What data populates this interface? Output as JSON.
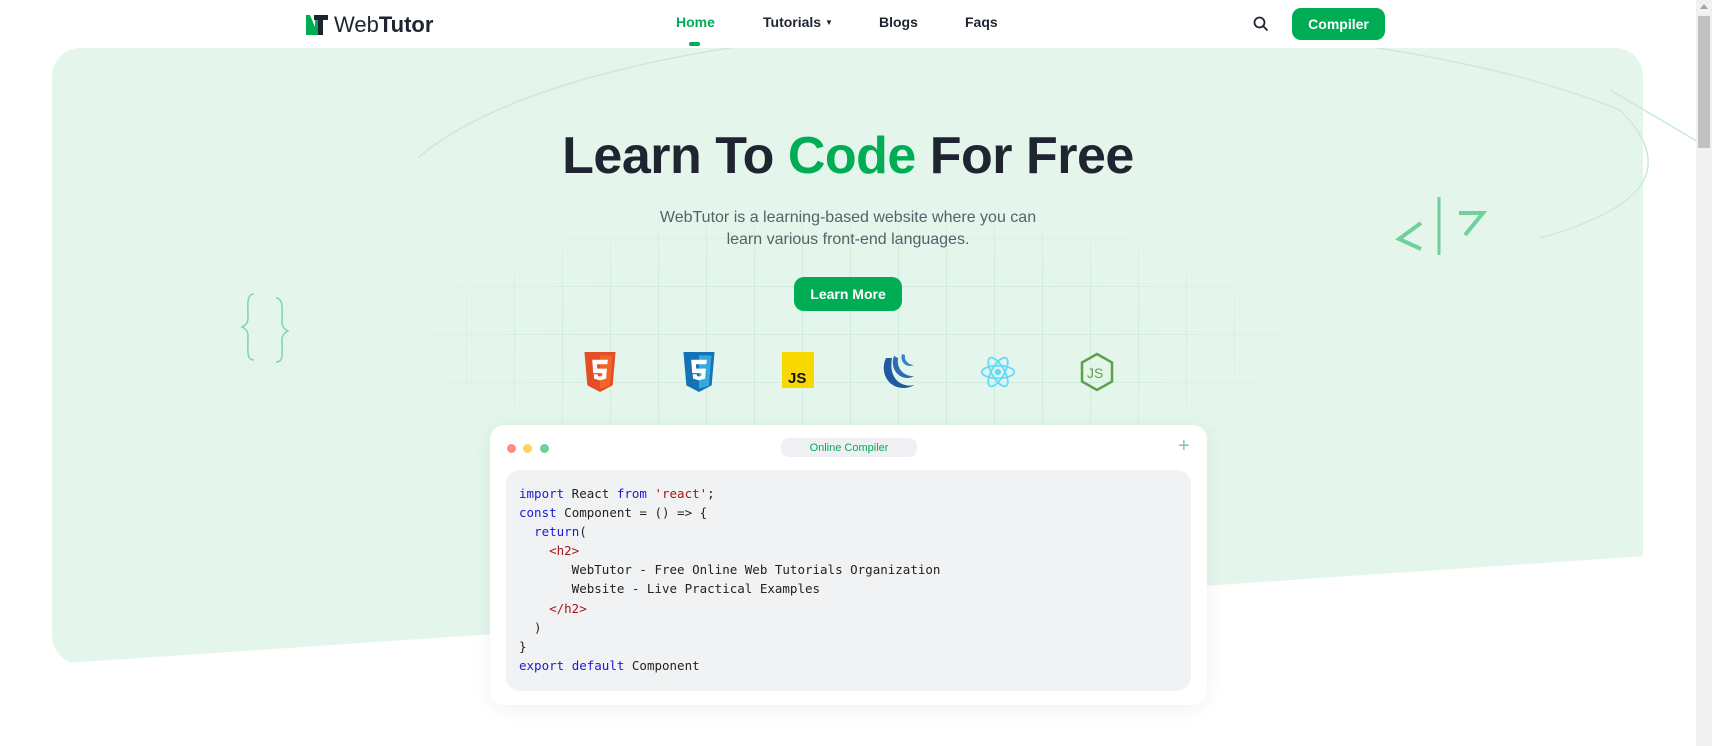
{
  "nav": {
    "brand_light": "Web",
    "brand_bold": "Tutor",
    "links": [
      {
        "label": "Home",
        "active": true
      },
      {
        "label": "Tutorials"
      },
      {
        "label": "Blogs"
      },
      {
        "label": "Faqs"
      }
    ],
    "compiler_label": "Compiler"
  },
  "hero": {
    "title_pre": "Learn To ",
    "title_accent": "Code",
    "title_post": " For Free",
    "subtitle_line1": "WebTutor is a learning-based website where you can",
    "subtitle_line2": "learn various front-end languages.",
    "cta": "Learn More",
    "tech_icons": [
      "html5-icon",
      "css3-icon",
      "javascript-icon",
      "jquery-icon",
      "react-icon",
      "nodejs-icon"
    ]
  },
  "compiler": {
    "title": "Online Compiler",
    "code": [
      [
        [
          "kw",
          "import"
        ],
        [
          "t",
          " React "
        ],
        [
          "kw",
          "from"
        ],
        [
          "t",
          " "
        ],
        [
          "str",
          "'react'"
        ],
        [
          "t",
          ";"
        ]
      ],
      [
        [
          "kw",
          "const"
        ],
        [
          "t",
          " Component = () => {"
        ]
      ],
      [
        [
          "t",
          "  "
        ],
        [
          "kw",
          "return"
        ],
        [
          "t",
          "("
        ]
      ],
      [
        [
          "t",
          "    "
        ],
        [
          "tag",
          "<h2>"
        ]
      ],
      [
        [
          "t",
          "       WebTutor - Free Online Web Tutorials Organization"
        ]
      ],
      [
        [
          "t",
          "       Website - Live Practical Examples"
        ]
      ],
      [
        [
          "t",
          "    "
        ],
        [
          "tag",
          "</h2>"
        ]
      ],
      [
        [
          "t",
          "  )"
        ]
      ],
      [
        [
          "t",
          "}"
        ]
      ],
      [
        [
          "kw",
          "export"
        ],
        [
          "t",
          " "
        ],
        [
          "kw",
          "default"
        ],
        [
          "t",
          " Component"
        ]
      ]
    ]
  },
  "colors": {
    "accent": "#00ad55",
    "hero_bg": "#e4f6eb"
  }
}
